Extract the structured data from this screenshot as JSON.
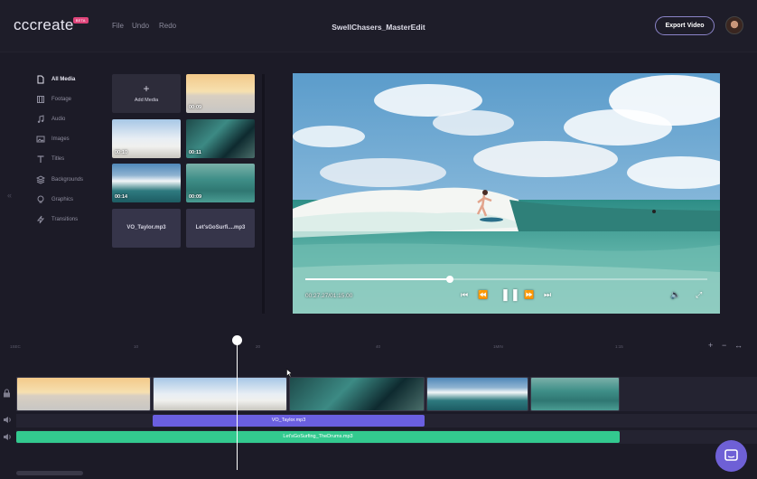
{
  "app": {
    "logo": "cccreate",
    "logo_badge": "BETA"
  },
  "menu": {
    "file": "File",
    "undo": "Undo",
    "redo": "Redo"
  },
  "project_title": "SwellChasers_MasterEdit",
  "export_label": "Export Video",
  "sidebar": {
    "collapse": "«",
    "items": [
      {
        "label": "All Media",
        "icon": "file-icon",
        "active": true
      },
      {
        "label": "Footage",
        "icon": "film-icon"
      },
      {
        "label": "Audio",
        "icon": "music-icon"
      },
      {
        "label": "Images",
        "icon": "image-icon"
      },
      {
        "label": "Titles",
        "icon": "text-icon"
      },
      {
        "label": "Backgrounds",
        "icon": "layers-icon"
      },
      {
        "label": "Graphics",
        "icon": "graphics-icon"
      },
      {
        "label": "Transitions",
        "icon": "transitions-icon"
      }
    ]
  },
  "media": {
    "add": {
      "plus": "+",
      "label": "Add Media"
    },
    "tiles": [
      {
        "duration": "00:09",
        "style": "sky1"
      },
      {
        "duration": "00:10",
        "style": "sky2"
      },
      {
        "duration": "00:11",
        "style": "wave1"
      },
      {
        "duration": "00:14",
        "style": "wave2"
      },
      {
        "duration": "00:09",
        "style": "wave3"
      }
    ],
    "audio_tiles": [
      "VO_Taylor.mp3",
      "Let'sGoSurfi....mp3"
    ]
  },
  "player": {
    "timecode": "00:27.27/01:15.00",
    "progress": 0.36,
    "controls": {
      "skip_back": "⏮",
      "rewind": "⏪",
      "pause": "❚❚",
      "forward": "⏩",
      "skip_forward": "⏭",
      "volume": "🔈",
      "fullscreen": "⤢"
    }
  },
  "timeline": {
    "ruler": [
      "1SEC",
      "10",
      "20",
      "40",
      "1MIN",
      "1:15"
    ],
    "zoom": {
      "in": "+",
      "out": "−",
      "fit": "↔"
    },
    "audio_tracks": [
      "VO_Taylor.mp3",
      "Let'sGoSurfing_TheDrums.mp3"
    ]
  },
  "colors": {
    "accent": "#6e60d6",
    "vo_clip": "#6a5fe0",
    "music_clip": "#33c98f",
    "background": "#1c1b27"
  }
}
